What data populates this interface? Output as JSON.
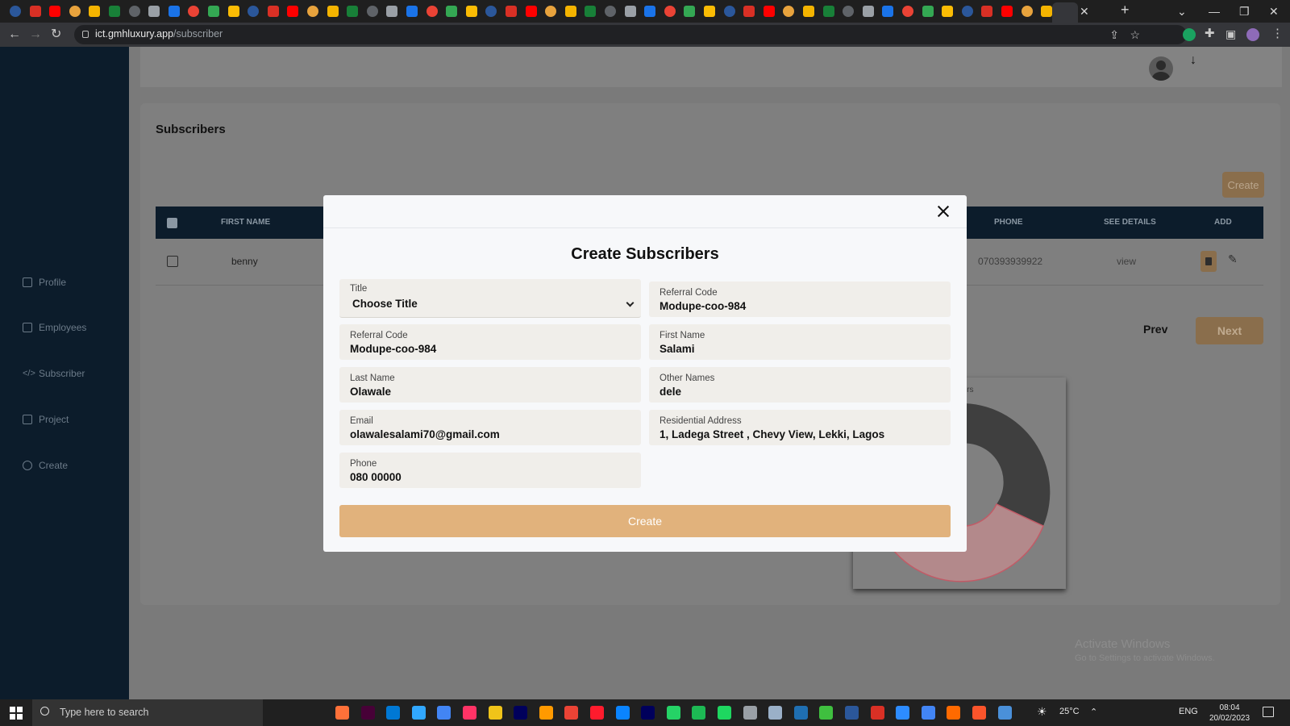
{
  "browser": {
    "url_host": "ict.gmhluxury.app",
    "url_path": "/subscriber"
  },
  "sidebar": {
    "items": [
      {
        "label": "Profile",
        "icon": "grid-icon"
      },
      {
        "label": "Employees",
        "icon": "puzzle-icon"
      },
      {
        "label": "Subscriber",
        "icon": "code-icon"
      },
      {
        "label": "Project",
        "icon": "puzzle-icon"
      },
      {
        "label": "Create",
        "icon": "compass-icon"
      }
    ]
  },
  "page": {
    "title": "Subscribers",
    "create_button": "Create",
    "table": {
      "headers": {
        "first_name": "FIRST NAME",
        "phone": "PHONE",
        "see_details": "SEE DETAILS",
        "add": "ADD"
      },
      "rows": [
        {
          "first_name": "benny",
          "phone": "070393939922",
          "details_link": "view"
        }
      ]
    },
    "pagination": {
      "prev": "Prev",
      "next": "Next"
    },
    "chart_label": "scribers"
  },
  "modal": {
    "title": "Create Subscribers",
    "fields": {
      "title": {
        "label": "Title",
        "value": "Choose Title"
      },
      "referral_code_right": {
        "label": "Referral Code",
        "value": "Modupe-coo-984"
      },
      "referral_code_left": {
        "label": "Referral Code",
        "value": "Modupe-coo-984"
      },
      "first_name": {
        "label": "First Name",
        "value": "Salami"
      },
      "last_name": {
        "label": "Last Name",
        "value": "Olawale"
      },
      "other_names": {
        "label": "Other Names",
        "value": "dele"
      },
      "email": {
        "label": "Email",
        "value": "olawalesalami70@gmail.com"
      },
      "address": {
        "label": "Residential Address",
        "value": "1, Ladega Street , Chevy View, Lekki, Lagos"
      },
      "phone": {
        "label": "Phone",
        "value": "080 00000"
      }
    },
    "submit_label": "Create"
  },
  "watermark": {
    "line1": "Activate Windows",
    "line2": "Go to Settings to activate Windows."
  },
  "taskbar": {
    "search_placeholder": "Type here to search",
    "weather": "25°C",
    "language": "ENG",
    "time": "08:04",
    "date": "20/02/2023"
  },
  "colors": {
    "sidebar_bg": "#0c1c2b",
    "accent": "#e1b27c",
    "overlay_bg": "#7f7f7f",
    "modal_bg": "#f7f8fa",
    "field_bg": "#f0eeea"
  }
}
